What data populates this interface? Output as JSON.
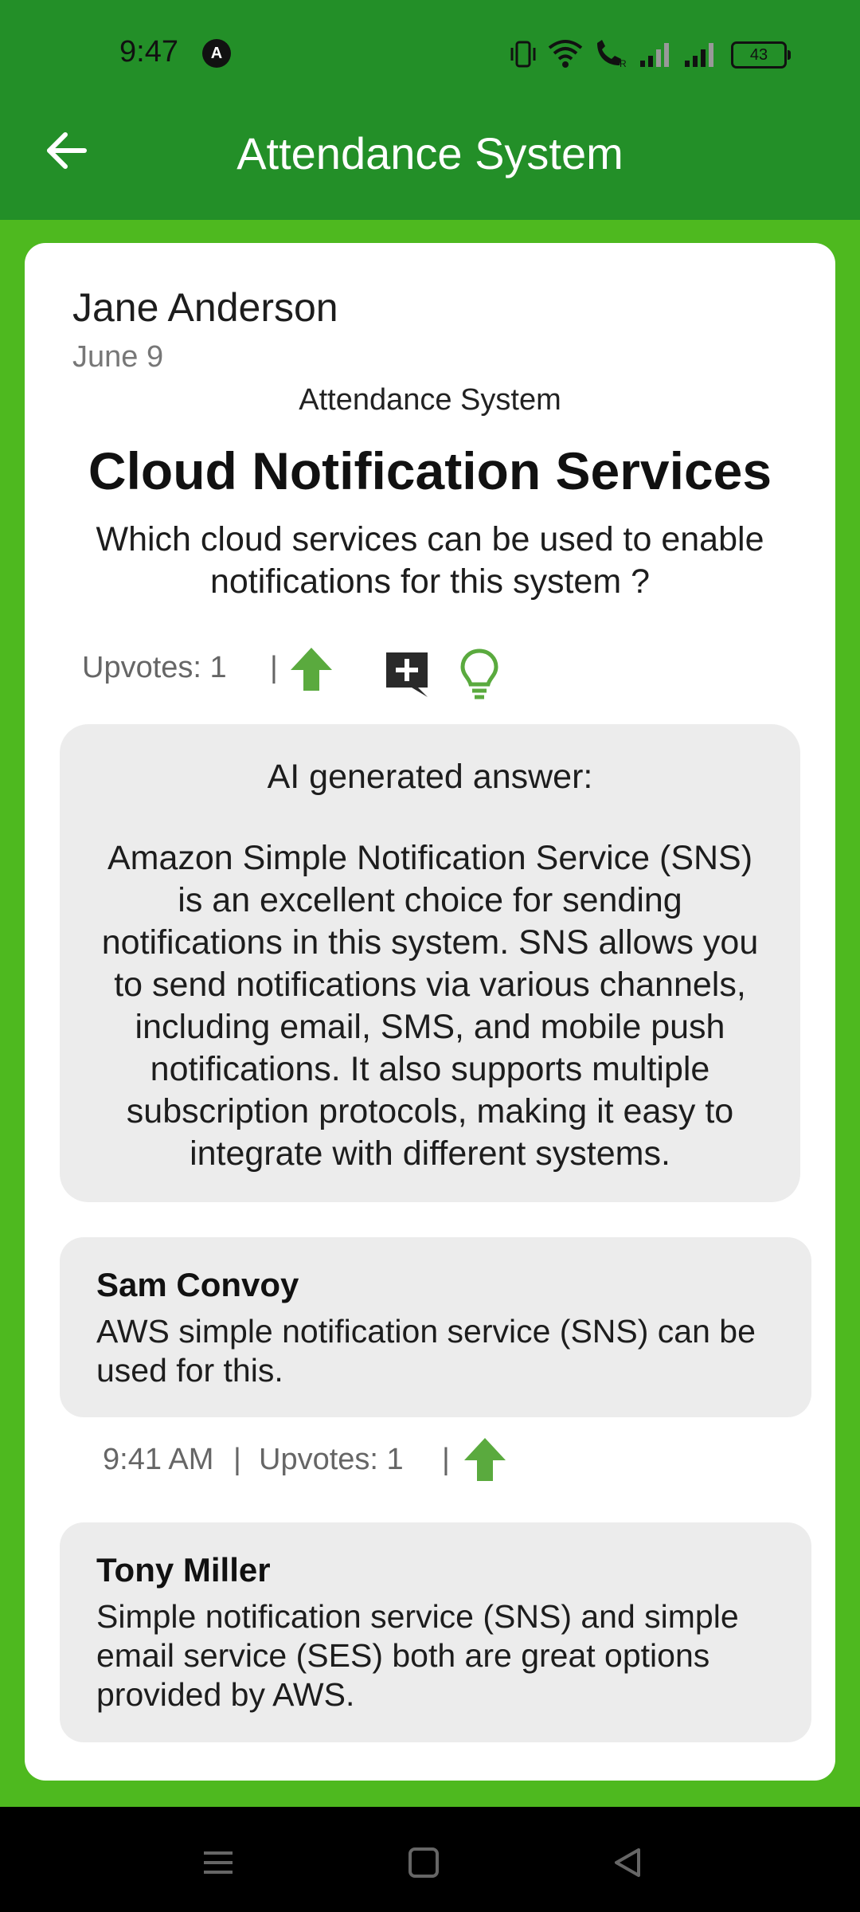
{
  "status_bar": {
    "time": "9:47",
    "notification_icon": "A",
    "battery": "43"
  },
  "header": {
    "title": "Attendance System",
    "back_icon": "arrow-left-icon"
  },
  "post": {
    "author": "Jane Anderson",
    "date": "June 9",
    "category": "Attendance System",
    "title": "Cloud Notification Services",
    "body": "Which cloud services can be used to enable notifications for this system ?",
    "upvotes_label": "Upvotes: 1",
    "separator": "|"
  },
  "ai_answer": {
    "label": "AI generated answer:",
    "text": "Amazon Simple Notification Service (SNS) is an excellent choice for sending notifications in this system. SNS allows you to send notifications via various channels, including email, SMS, and mobile push notifications. It also supports multiple subscription protocols, making it easy to integrate with different systems."
  },
  "comments": [
    {
      "name": "Sam Convoy",
      "text": "AWS simple notification service (SNS) can be used for this.",
      "time": "9:41 AM",
      "upvotes": "Upvotes: 1"
    },
    {
      "name": "Tony Miller",
      "text": "Simple notification service (SNS) and simple email service (SES) both are great options provided by AWS."
    }
  ],
  "colors": {
    "header": "#238f28",
    "background": "#4eb91f",
    "accent": "#5aaa3e"
  }
}
